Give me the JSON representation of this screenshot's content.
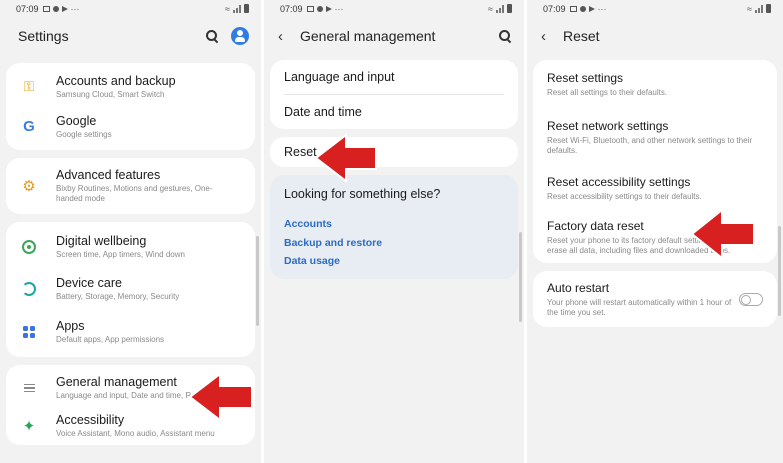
{
  "status": {
    "time": "07:09",
    "more": "···"
  },
  "screen1": {
    "title": "Settings",
    "items": [
      {
        "title": "Accounts and backup",
        "sub": "Samsung Cloud, Smart Switch",
        "icon": "key-icon"
      },
      {
        "title": "Google",
        "sub": "Google settings",
        "icon": "google-icon"
      },
      {
        "title": "Advanced features",
        "sub": "Bixby Routines, Motions and gestures, One-handed mode",
        "icon": "advanced-features-icon"
      },
      {
        "title": "Digital wellbeing",
        "sub": "Screen time, App timers, Wind down",
        "icon": "digital-wellbeing-icon"
      },
      {
        "title": "Device care",
        "sub": "Battery, Storage, Memory, Security",
        "icon": "device-care-icon"
      },
      {
        "title": "Apps",
        "sub": "Default apps, App permissions",
        "icon": "apps-icon"
      },
      {
        "title": "General management",
        "sub": "Language and input, Date and time, Reset",
        "icon": "general-management-icon"
      },
      {
        "title": "Accessibility",
        "sub": "Voice Assistant, Mono audio, Assistant menu",
        "icon": "accessibility-icon"
      }
    ]
  },
  "screen2": {
    "title": "General management",
    "items": [
      "Language and input",
      "Date and time",
      "Reset"
    ],
    "looking_title": "Looking for something else?",
    "links": [
      "Accounts",
      "Backup and restore",
      "Data usage"
    ]
  },
  "screen3": {
    "title": "Reset",
    "items": [
      {
        "title": "Reset settings",
        "sub": "Reset all settings to their defaults."
      },
      {
        "title": "Reset network settings",
        "sub": "Reset Wi-Fi, Bluetooth, and other network settings to their defaults."
      },
      {
        "title": "Reset accessibility settings",
        "sub": "Reset accessibility settings to their defaults."
      },
      {
        "title": "Factory data reset",
        "sub": "Reset your phone to its factory default settings. This will erase all data, including files and downloaded apps."
      }
    ],
    "auto_restart": {
      "title": "Auto restart",
      "sub": "Your phone will restart automatically within 1 hour of the time you set.",
      "enabled": false
    }
  },
  "colors": {
    "background": "#f2f2f2",
    "card": "#ffffff",
    "link": "#2b6cc4",
    "arrow": "#d92020",
    "looking_card": "#e8edf3"
  }
}
